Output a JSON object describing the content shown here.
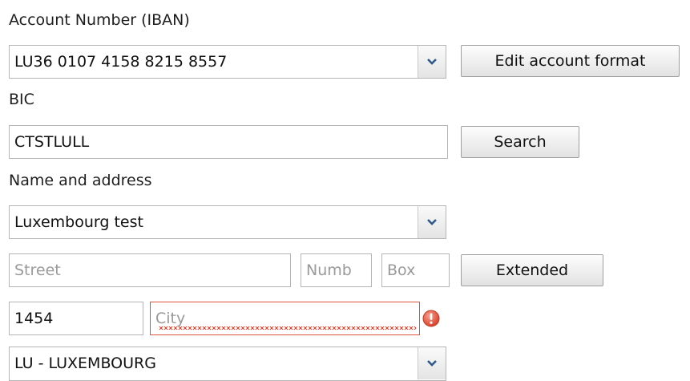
{
  "iban": {
    "label": "Account Number (IBAN)",
    "value": "LU36 0107 4158 8215 8557",
    "edit_button": "Edit account format"
  },
  "bic": {
    "label": "BIC",
    "value": "CTSTLULL",
    "search_button": "Search"
  },
  "name_address": {
    "label": "Name and address",
    "name_value": "Luxembourg test",
    "street_placeholder": "Street",
    "number_placeholder": "Numb",
    "box_placeholder": "Box",
    "extended_button": "Extended",
    "postal_code": "1454",
    "city_placeholder": "City",
    "country_value": "LU - LUXEMBOURG"
  },
  "colors": {
    "error": "#e0412b",
    "border": "#b5b5b5"
  }
}
